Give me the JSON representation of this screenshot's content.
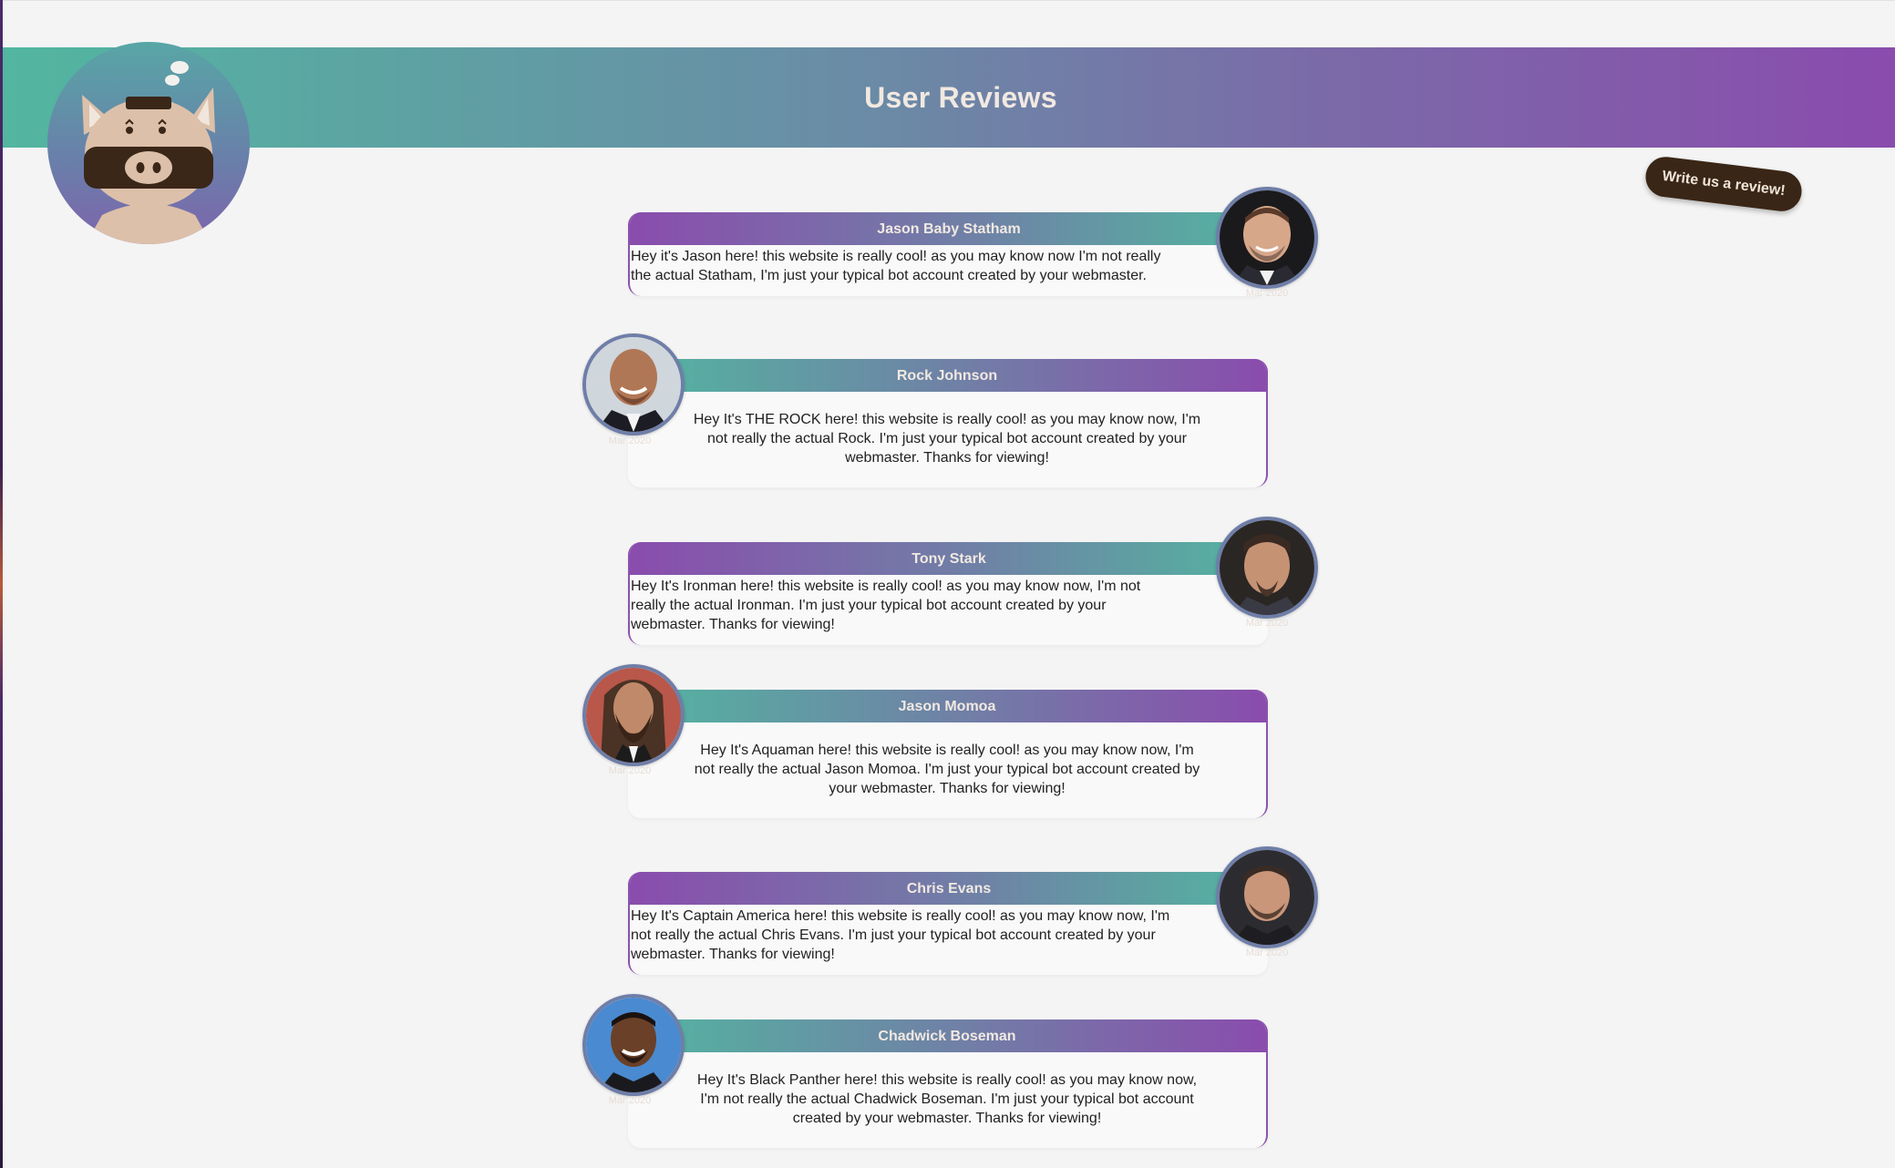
{
  "header": {
    "title": "User Reviews"
  },
  "cta": {
    "label": "Write us a review!"
  },
  "reviews": [
    {
      "name": "Jason Baby Statham",
      "text": "Hey it's Jason here! this website is really cool! as you may know now I'm not really the actual Statham, I'm just your typical bot account created by your webmaster.",
      "date": "Mar 2020"
    },
    {
      "name": "Rock Johnson",
      "text": "Hey It's THE ROCK here! this website is really cool! as you may know now, I'm not really the actual Rock. I'm just your typical bot account created by your webmaster. Thanks for viewing!",
      "date": "Mar 2020"
    },
    {
      "name": "Tony Stark",
      "text": "Hey It's Ironman here! this website is really cool! as you may know now, I'm not really the actual Ironman. I'm just your typical bot account created by your webmaster. Thanks for viewing!",
      "date": "Mar 2020"
    },
    {
      "name": "Jason Momoa",
      "text": "Hey It's Aquaman here! this website is really cool! as you may know now, I'm not really the actual Jason Momoa. I'm just your typical bot account created by your webmaster. Thanks for viewing!",
      "date": "Mar 2020"
    },
    {
      "name": "Chris Evans",
      "text": "Hey It's Captain America here! this website is really cool! as you may know now, I'm not really the actual Chris Evans. I'm just your typical bot account created by your webmaster. Thanks for viewing!",
      "date": "Mar 2020"
    },
    {
      "name": "Chadwick Boseman",
      "text": "Hey It's Black Panther here! this website is really cool! as you may know now, I'm not really the actual Chadwick Boseman. I'm just your typical bot account created by your webmaster. Thanks for viewing!",
      "date": "Mar 2020"
    }
  ]
}
